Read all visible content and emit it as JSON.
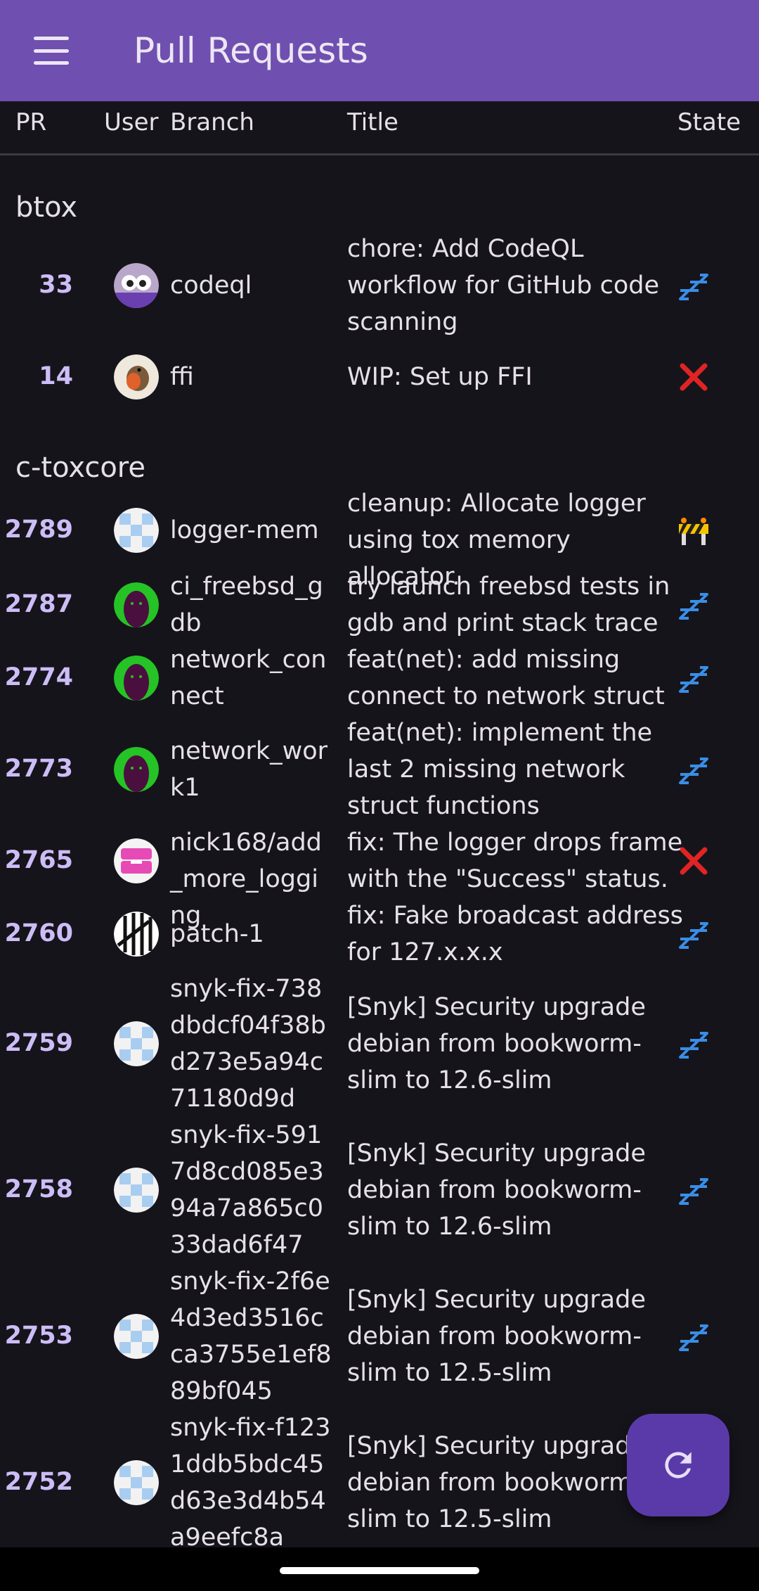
{
  "appbar": {
    "title": "Pull Requests",
    "menu_icon": "hamburger-menu-icon"
  },
  "table": {
    "columns": {
      "pr": "PR",
      "user": "User",
      "branch": "Branch",
      "title": "Title",
      "state": "State"
    }
  },
  "groups": [
    {
      "name": "btox",
      "rows": [
        {
          "pr": "33",
          "avatar": "owl-avatar",
          "branch": "codeql",
          "title": "chore: Add CodeQL workflow for GitHub code scanning",
          "state": "sleeping"
        },
        {
          "pr": "14",
          "avatar": "robin-avatar",
          "branch": "ffi",
          "title": "WIP: Set up FFI",
          "state": "failed"
        }
      ]
    },
    {
      "name": "c-toxcore",
      "rows": [
        {
          "pr": "2789",
          "avatar": "checker-avatar",
          "branch": "logger-mem",
          "title": "cleanup: Allocate logger using tox memory allocator.",
          "state": "construction"
        },
        {
          "pr": "2787",
          "avatar": "green-avatar",
          "branch": "ci_freebsd_gdb",
          "title": "try launch freebsd tests in gdb and print stack trace",
          "state": "sleeping"
        },
        {
          "pr": "2774",
          "avatar": "green-avatar",
          "branch": "network_connect",
          "title": "feat(net): add missing connect to network struct",
          "state": "sleeping"
        },
        {
          "pr": "2773",
          "avatar": "green-avatar",
          "branch": "network_work1",
          "title": "feat(net): implement the last 2 missing network struct functions",
          "state": "sleeping"
        },
        {
          "pr": "2765",
          "avatar": "pink-avatar",
          "branch": "nick168/add_more_logging",
          "title": "fix: The logger drops frame with the \"Success\" status.",
          "state": "failed"
        },
        {
          "pr": "2760",
          "avatar": "pattern-avatar",
          "branch": "patch-1",
          "title": "fix: Fake broadcast address for 127.x.x.x",
          "state": "sleeping"
        },
        {
          "pr": "2759",
          "avatar": "checker-avatar",
          "branch": "snyk-fix-738dbdcf04f38bd273e5a94c71180d9d",
          "title": "[Snyk] Security upgrade debian from bookworm-slim to 12.6-slim",
          "state": "sleeping"
        },
        {
          "pr": "2758",
          "avatar": "checker-avatar",
          "branch": "snyk-fix-5917d8cd085e394a7a865c033dad6f47",
          "title": "[Snyk] Security upgrade debian from bookworm-slim to 12.6-slim",
          "state": "sleeping"
        },
        {
          "pr": "2753",
          "avatar": "checker-avatar",
          "branch": "snyk-fix-2f6e4d3ed3516cca3755e1ef889bf045",
          "title": "[Snyk] Security upgrade debian from bookworm-slim to 12.5-slim",
          "state": "sleeping"
        },
        {
          "pr": "2752",
          "avatar": "checker-avatar",
          "branch": "snyk-fix-f1231ddb5bdc45d63e3d4b54a9eefc8a",
          "title": "[Snyk] Security upgrade debian from bookworm-slim to 12.5-slim",
          "state": "sleeping"
        }
      ]
    }
  ],
  "fab": {
    "icon": "refresh-icon"
  },
  "colors": {
    "appbar": "#6f4fb0",
    "background": "#16141b",
    "pr_number": "#cdbdf7",
    "fab": "#5a3aa8",
    "failed": "#e02424",
    "sleeping": "#3a8ee6"
  }
}
